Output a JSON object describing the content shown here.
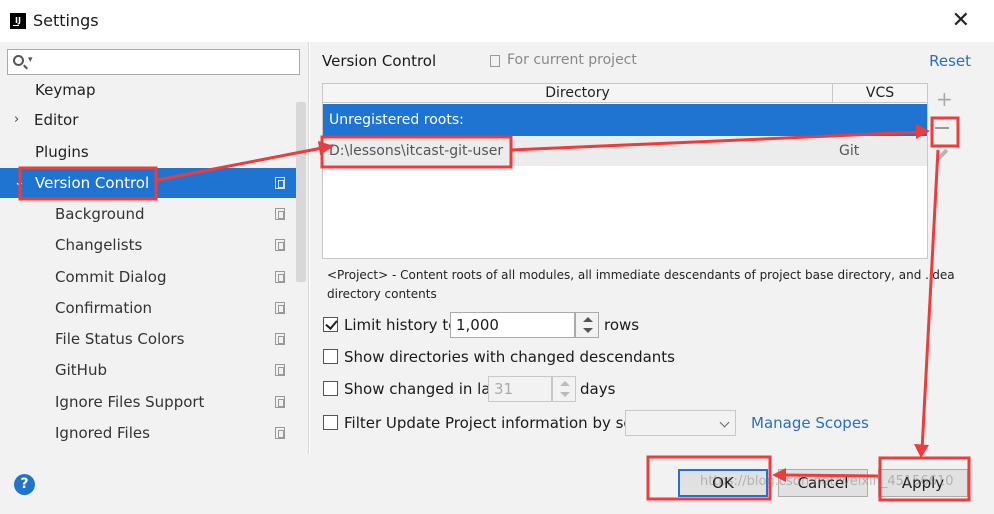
{
  "window": {
    "title": "Settings",
    "close_glyph": "✕"
  },
  "colors": {
    "selection": "#1e74d0",
    "link": "#2870c0",
    "annotation": "#ee3b3b"
  },
  "sidebar": {
    "search_placeholder": "",
    "items": [
      {
        "label": "Keymap"
      },
      {
        "label": "Editor",
        "arrow": "›"
      },
      {
        "label": "Plugins"
      },
      {
        "label": "Version Control",
        "arrow": "⌄"
      },
      {
        "label": "Background"
      },
      {
        "label": "Changelists"
      },
      {
        "label": "Commit Dialog"
      },
      {
        "label": "Confirmation"
      },
      {
        "label": "File Status Colors"
      },
      {
        "label": "GitHub"
      },
      {
        "label": "Ignore Files Support"
      },
      {
        "label": "Ignored Files"
      }
    ]
  },
  "content": {
    "title": "Version Control",
    "scope_label": "For current project",
    "reset_label": "Reset",
    "table": {
      "headers": {
        "directory": "Directory",
        "vcs": "VCS"
      },
      "group_label": "Unregistered roots:",
      "rows": [
        {
          "directory": "D:\\lessons\\itcast-git-user",
          "vcs": "Git"
        }
      ]
    },
    "toolbar": {
      "add": "+",
      "remove": "−",
      "edit": "edit"
    },
    "description": "<Project> - Content roots of all modules, all immediate descendants of project base directory, and .idea directory contents",
    "options": {
      "limit_history": {
        "label": "Limit history to:",
        "value": "1,000",
        "suffix": "rows",
        "checked": true
      },
      "show_dirs": {
        "label": "Show directories with changed descendants",
        "checked": false
      },
      "show_changed": {
        "label": "Show changed in last",
        "value": "31",
        "suffix": "days",
        "checked": false
      },
      "filter_update": {
        "label": "Filter Update Project information by scope",
        "select_value": "",
        "link": "Manage Scopes",
        "checked": false
      }
    }
  },
  "footer": {
    "help": "?",
    "ok": "OK",
    "cancel": "Cancel",
    "apply": "Apply",
    "watermark": "https://blog.csdn.net/weixin_45156610"
  }
}
